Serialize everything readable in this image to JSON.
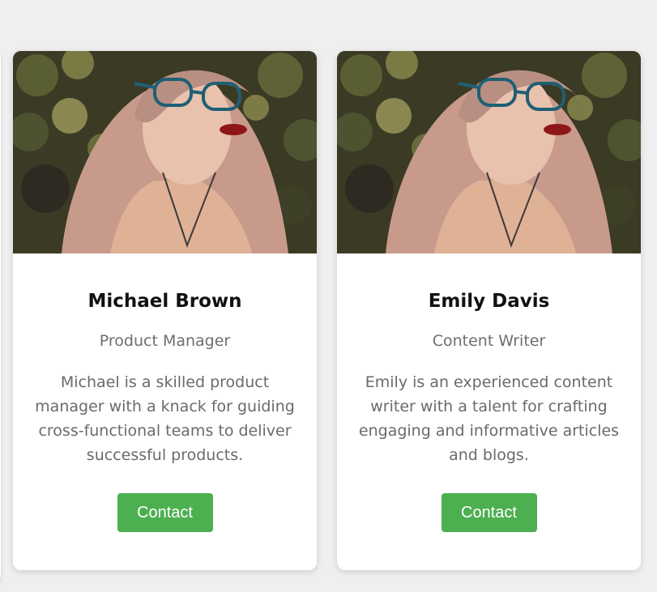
{
  "cards": [
    {
      "name": "Michael Brown",
      "role": "Product Manager",
      "bio": "Michael is a skilled product manager with a knack for guiding cross-functional teams to deliver successful products.",
      "button_label": "Contact"
    },
    {
      "name": "Emily Davis",
      "role": "Content Writer",
      "bio": "Emily is an experienced content writer with a talent for crafting engaging and informative articles and blogs.",
      "button_label": "Contact"
    }
  ],
  "colors": {
    "page_background": "#efefef",
    "card_background": "#ffffff",
    "button": "#4caf50",
    "name_text": "#111111",
    "secondary_text": "#6e6e6e"
  }
}
